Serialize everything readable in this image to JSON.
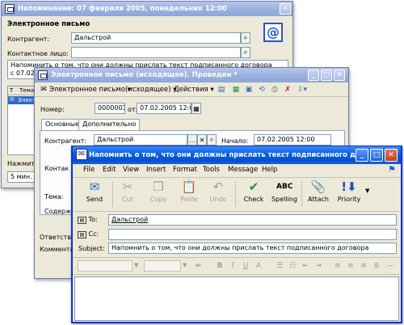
{
  "reminder": {
    "title": "Напоминание: 07 февраля 2005, понедельник 12:00",
    "heading": "Электронное письмо",
    "contractor_label": "Контрагент:",
    "contractor_value": "Дальстрой",
    "contact_label": "Контактное лицо:",
    "text_line1": "Напоминить о том, что они должны прислать текст подписанного договора",
    "text_line2": "с 07.02.",
    "col_icon": "T",
    "col_tema": "Тема",
    "row1": "Электр",
    "press_label": "Нажмит",
    "delay_value": "5 мин."
  },
  "doc": {
    "title": "Электронное письмо (исходящее). Проведен *",
    "toolbar_type": "Электронное письмо",
    "toolbar_kind": "(исходящее)",
    "toolbar_actions": "Действия",
    "number_label": "Номер:",
    "number_value": "0000001",
    "from_label": "от:",
    "date_value": "07.02.2005 12:0",
    "tab_main": "Основные",
    "tab_extra": "Дополнительно",
    "contractor_label": "Контрагент:",
    "contractor_value": "Дальстрой",
    "start_label": "Начало:",
    "start_value": "07.02.2005 12:00",
    "contact_label": "Контак",
    "tema_label": "Тема:",
    "content_label": "Содержа",
    "resp_label": "Ответств",
    "comment_label": "Коммента"
  },
  "outlook": {
    "title": "Напомнить о том, что они должны прислать текст подписанного догов...",
    "menu": [
      "File",
      "Edit",
      "View",
      "Insert",
      "Format",
      "Tools",
      "Message",
      "Help"
    ],
    "tools": {
      "send": "Send",
      "cut": "Cut",
      "copy": "Copy",
      "paste": "Paste",
      "undo": "Undo",
      "check": "Check",
      "spelling": "Spelling",
      "attach": "Attach",
      "priority": "Priority"
    },
    "to_label": "To:",
    "to_value": "Дальстрой",
    "cc_label": "Cc:",
    "cc_value": "",
    "subject_label": "Subject:",
    "subject_value": "Напомнить о том, что они должны прислать текст подписанного договора"
  }
}
